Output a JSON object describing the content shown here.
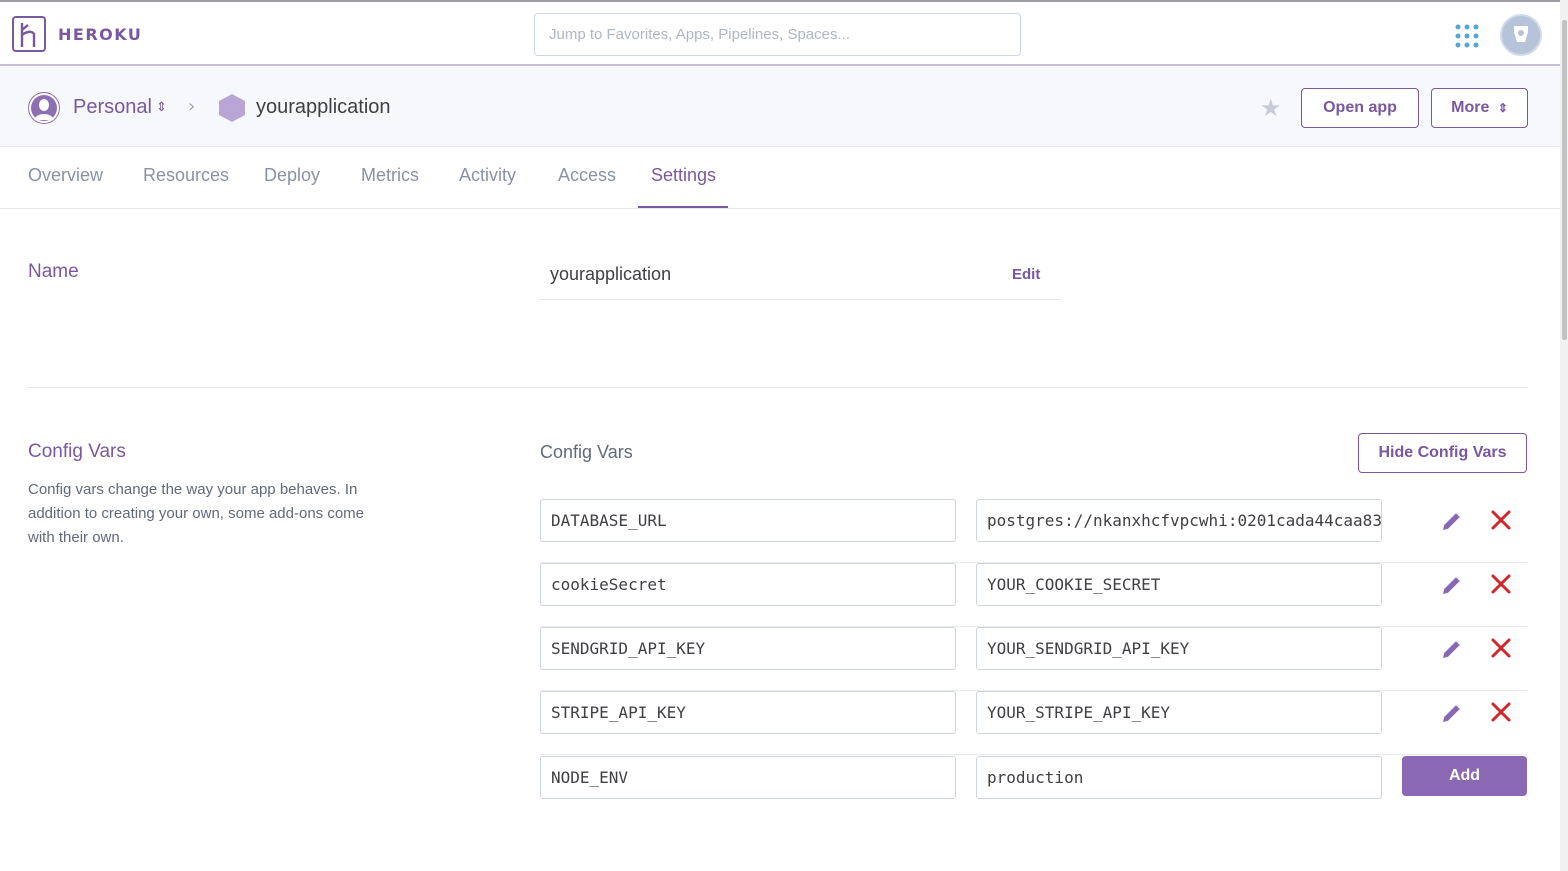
{
  "topbar": {
    "brand": "HEROKU",
    "search_placeholder": "Jump to Favorites, Apps, Pipelines, Spaces..."
  },
  "header": {
    "account": "Personal",
    "app_name": "yourapplication",
    "open_app": "Open app",
    "more": "More"
  },
  "tabs": [
    "Overview",
    "Resources",
    "Deploy",
    "Metrics",
    "Activity",
    "Access",
    "Settings"
  ],
  "active_tab": "Settings",
  "name_section": {
    "title": "Name",
    "value": "yourapplication",
    "edit": "Edit"
  },
  "config_section": {
    "title": "Config Vars",
    "description": "Config vars change the way your app behaves. In addition to creating your own, some add-ons come with their own.",
    "subtitle": "Config Vars",
    "hide_button": "Hide Config Vars",
    "vars": [
      {
        "key": "DATABASE_URL",
        "value": "postgres://nkanxhcfvpcwhi:0201cada44caa83"
      },
      {
        "key": "cookieSecret",
        "value": "YOUR_COOKIE_SECRET"
      },
      {
        "key": "SENDGRID_API_KEY",
        "value": "YOUR_SENDGRID_API_KEY"
      },
      {
        "key": "STRIPE_API_KEY",
        "value": "YOUR_STRIPE_API_KEY"
      }
    ],
    "new_var": {
      "key": "NODE_ENV",
      "value": "production"
    },
    "add_button": "Add"
  },
  "colors": {
    "brand": "#79589f",
    "add_button": "#8a68b3",
    "delete": "#d0262d"
  }
}
